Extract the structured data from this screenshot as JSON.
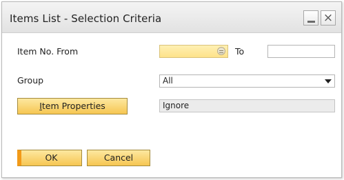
{
  "window": {
    "title": "Items List - Selection Criteria",
    "minimize_label": "_",
    "close_label": "×"
  },
  "fields": {
    "item_no_from_label": "Item No. From",
    "item_no_from_value": "",
    "to_label": "To",
    "item_no_to_value": "",
    "group_label": "Group",
    "group_value": "All",
    "item_properties_value": "Ignore"
  },
  "buttons": {
    "item_properties": "Item Properties",
    "ok": "OK",
    "cancel": "Cancel"
  },
  "colors": {
    "accent": "#f6c652",
    "active_field": "#fde28a",
    "ok_marker": "#f29a19"
  },
  "icons": {
    "chooser": "chooser-icon",
    "dropdown": "chevron-down-icon",
    "minimize": "minimize-icon",
    "close": "close-icon"
  }
}
